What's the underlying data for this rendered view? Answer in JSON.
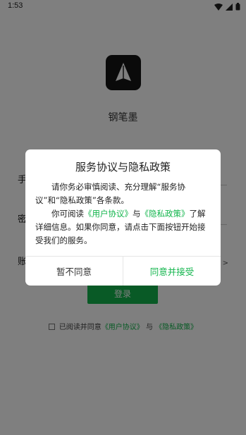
{
  "status_bar": {
    "time": "1:53"
  },
  "app": {
    "name": "钢笔墨"
  },
  "form": {
    "phone_label": "手",
    "password_label": "密",
    "account_label": "账",
    "agreement_right": "册 >",
    "login_label": "登录"
  },
  "consent": {
    "prefix": "已阅读并同意",
    "user_agreement": "《用户协议》",
    "and": "与",
    "privacy_policy": "《隐私政策》"
  },
  "dialog": {
    "title": "服务协议与隐私政策",
    "para1": "请你务必审慎阅读、充分理解“服务协议”和“隐私政策”各条款。",
    "para2_prefix": "你可阅读",
    "para2_user_agreement": "《用户协议》",
    "para2_and": "与",
    "para2_privacy": "《隐私政策》",
    "para2_suffix": "了解详细信息。如果你同意，请点击下面按钮开始接受我们的服务。",
    "decline_label": "暂不同意",
    "accept_label": "同意并接受"
  },
  "colors": {
    "accent": "#12b54c",
    "overlay": "rgba(0,0,0,0.5)"
  }
}
